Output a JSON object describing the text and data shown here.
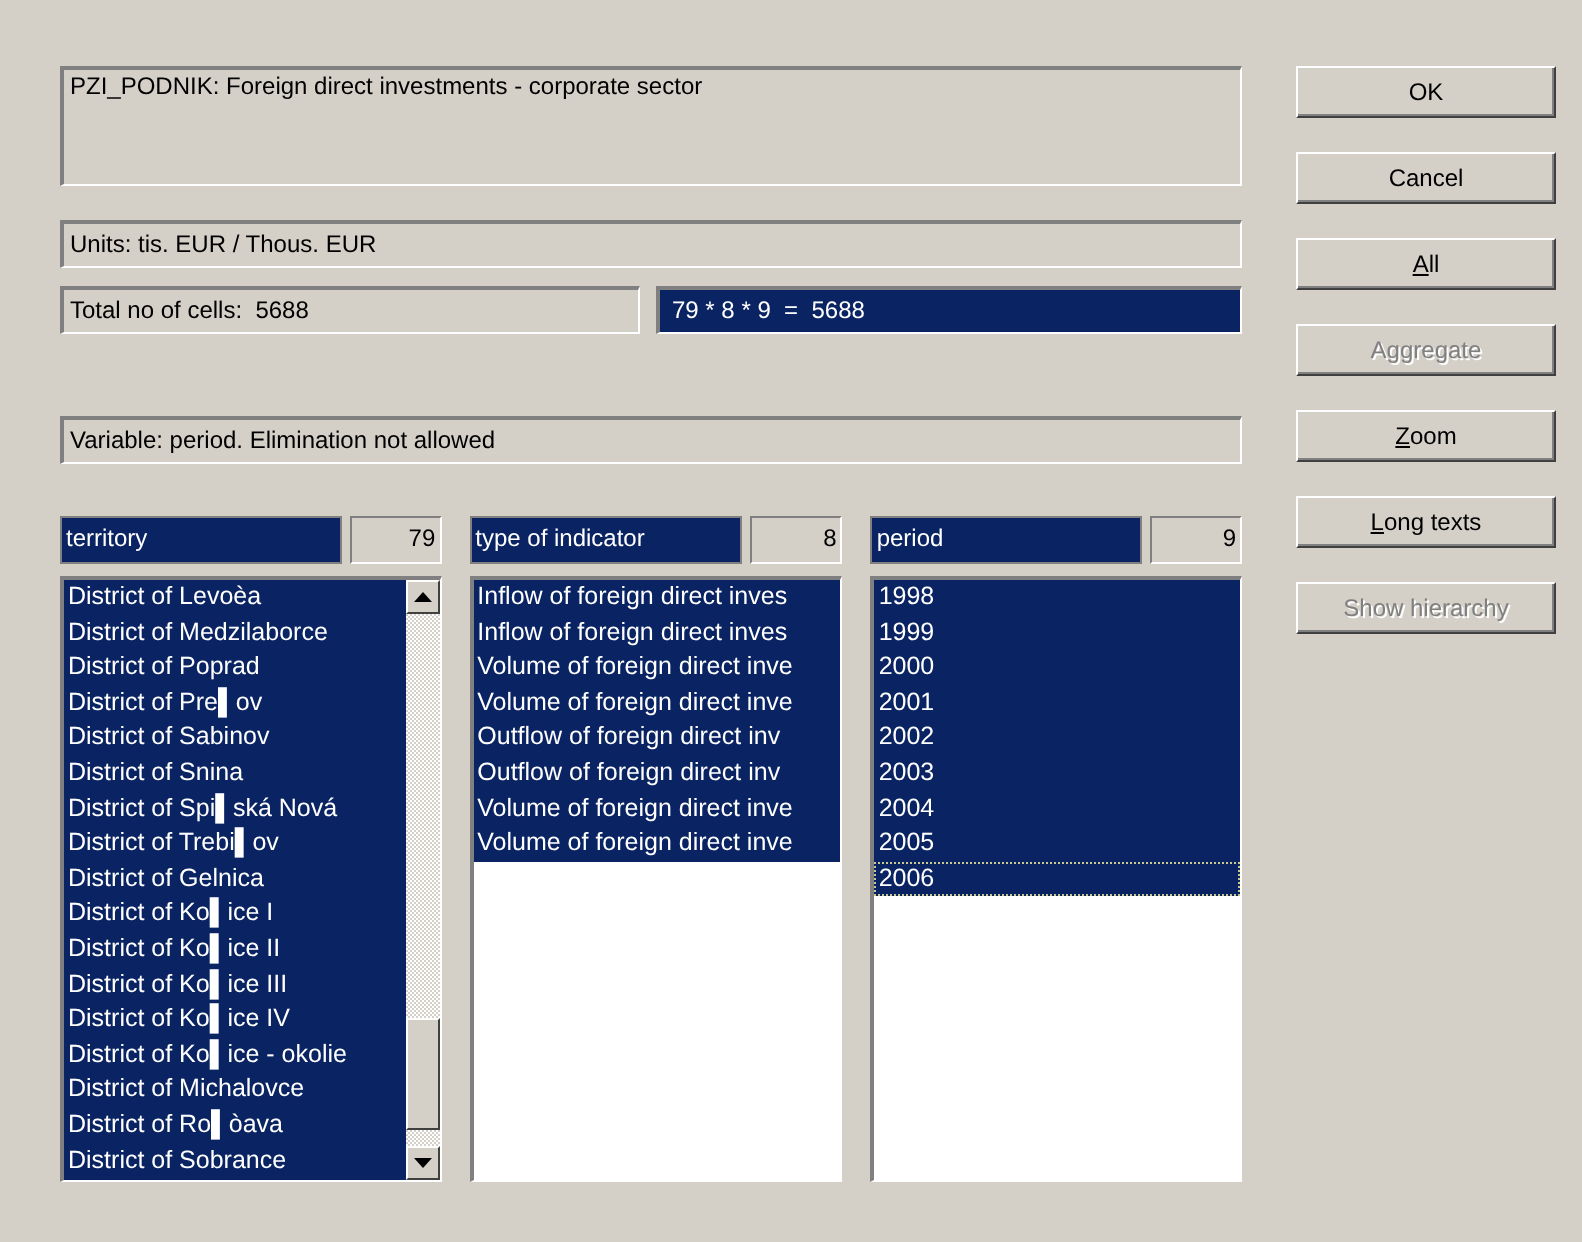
{
  "description": "PZI_PODNIK: Foreign direct investments - corporate sector",
  "units": "Units: tis. EUR / Thous. EUR",
  "total_cells": "Total no of cells:  5688",
  "formula": "79 * 8 * 9  =  5688",
  "variable_info": "Variable: period. Elimination not allowed",
  "lists": [
    {
      "name": "territory",
      "count": "79",
      "scrollbar": true,
      "items": [
        {
          "label": "District of Levoèa",
          "selected": true,
          "focused": false
        },
        {
          "label": "District of Medzilaborce",
          "selected": true,
          "focused": false
        },
        {
          "label": "District of Poprad",
          "selected": true,
          "focused": false
        },
        {
          "label": "District of Pre▌ov",
          "selected": true,
          "focused": false
        },
        {
          "label": "District of Sabinov",
          "selected": true,
          "focused": false
        },
        {
          "label": "District of Snina",
          "selected": true,
          "focused": false
        },
        {
          "label": "District of Spi▌ská Nová",
          "selected": true,
          "focused": false
        },
        {
          "label": "District of Trebi▌ov",
          "selected": true,
          "focused": false
        },
        {
          "label": "District of Gelnica",
          "selected": true,
          "focused": false
        },
        {
          "label": "District of Ko▌ice I",
          "selected": true,
          "focused": false
        },
        {
          "label": "District of Ko▌ice II",
          "selected": true,
          "focused": false
        },
        {
          "label": "District of Ko▌ice III",
          "selected": true,
          "focused": false
        },
        {
          "label": "District of Ko▌ice IV",
          "selected": true,
          "focused": false
        },
        {
          "label": "District of Ko▌ice - okolie",
          "selected": true,
          "focused": false
        },
        {
          "label": "District of Michalovce",
          "selected": true,
          "focused": false
        },
        {
          "label": "District of Ro▌òava",
          "selected": true,
          "focused": false
        },
        {
          "label": "District of Sobrance",
          "selected": true,
          "focused": false
        }
      ]
    },
    {
      "name": "type of indicator",
      "count": "8",
      "scrollbar": false,
      "items": [
        {
          "label": "Inflow of foreign direct inves",
          "selected": true,
          "focused": false
        },
        {
          "label": "Inflow of foreign direct inves",
          "selected": true,
          "focused": false
        },
        {
          "label": "Volume of foreign direct inve",
          "selected": true,
          "focused": false
        },
        {
          "label": "Volume of foreign direct inve",
          "selected": true,
          "focused": false
        },
        {
          "label": "Outflow of foreign direct inv",
          "selected": true,
          "focused": false
        },
        {
          "label": "Outflow of foreign direct inv",
          "selected": true,
          "focused": false
        },
        {
          "label": "Volume of foreign direct inve",
          "selected": true,
          "focused": false
        },
        {
          "label": "Volume of foreign direct inve",
          "selected": true,
          "focused": false
        }
      ]
    },
    {
      "name": "period",
      "count": "9",
      "scrollbar": false,
      "items": [
        {
          "label": "1998",
          "selected": true,
          "focused": false
        },
        {
          "label": "1999",
          "selected": true,
          "focused": false
        },
        {
          "label": "2000",
          "selected": true,
          "focused": false
        },
        {
          "label": "2001",
          "selected": true,
          "focused": false
        },
        {
          "label": "2002",
          "selected": true,
          "focused": false
        },
        {
          "label": "2003",
          "selected": true,
          "focused": false
        },
        {
          "label": "2004",
          "selected": true,
          "focused": false
        },
        {
          "label": "2005",
          "selected": true,
          "focused": false
        },
        {
          "label": "2006",
          "selected": true,
          "focused": true
        }
      ]
    }
  ],
  "buttons": [
    {
      "label": "OK",
      "disabled": false,
      "underline_first": false
    },
    {
      "label": "Cancel",
      "disabled": false,
      "underline_first": false
    },
    {
      "label": "All",
      "disabled": false,
      "underline_first": true
    },
    {
      "label": "Aggregate",
      "disabled": true,
      "underline_first": false
    },
    {
      "label": "Zoom",
      "disabled": false,
      "underline_first": true
    },
    {
      "label": "Long texts",
      "disabled": false,
      "underline_first": true
    },
    {
      "label": "Show hierarchy",
      "disabled": true,
      "underline_first": false
    }
  ]
}
